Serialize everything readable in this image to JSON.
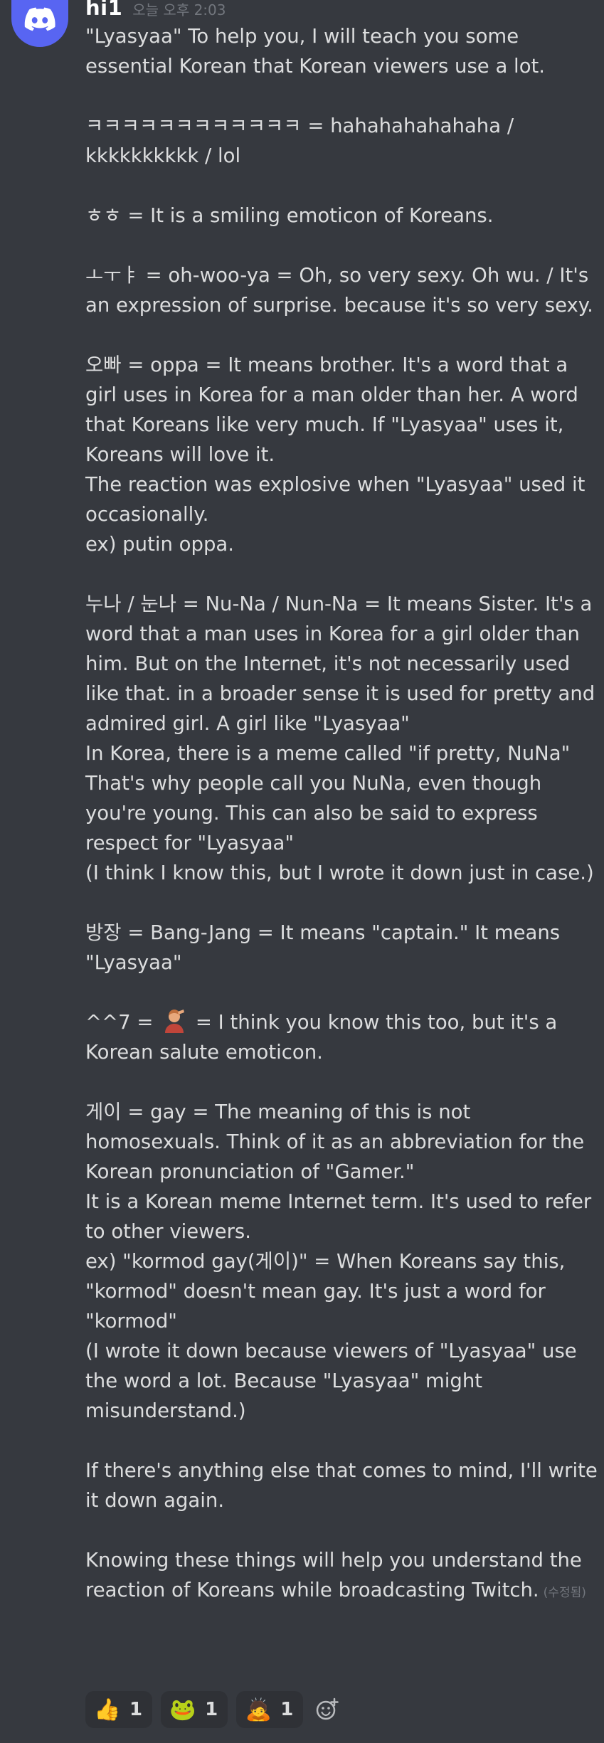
{
  "message": {
    "author": "hi1",
    "timestamp": "오늘 오후 2:03",
    "edited_label": "(수정됨)",
    "paragraphs": {
      "p0": "\"Lyasyaa\" To help you, I will teach you some essential Korean that Korean viewers use a lot.",
      "p1": "ㅋㅋㅋㅋㅋㅋㅋㅋㅋㅋㅋㅋ = hahahahahahaha / kkkkkkkkkk / lol",
      "p2": "ㅎㅎ = It is a smiling emoticon of Koreans.",
      "p3": "ㅗㅜㅑ = oh-woo-ya = Oh, so very sexy. Oh wu. / It's an expression of surprise. because it's so very sexy.",
      "p4": "오빠 = oppa = It means brother. It's a word that a girl uses in Korea for a man older than her. A word that Koreans like very much. If \"Lyasyaa\" uses it, Koreans will love it.\nThe reaction was explosive when \"Lyasyaa\" used it occasionally.\nex) putin oppa.",
      "p5": "누나 / 눈나 = Nu-Na / Nun-Na = It means Sister. It's a word that a man uses in Korea for a girl older than him. But on the Internet, it's not necessarily used like that. in a broader sense it is used for pretty and admired girl. A girl like \"Lyasyaa\"\nIn Korea, there is a meme called \"if pretty, NuNa\" That's why people call you NuNa, even though you're young. This can also be said to express respect for \"Lyasyaa\"\n(I think I know this, but I wrote it down just in case.)",
      "p6": "방장 = Bang-Jang = It means \"captain.\" It means \"Lyasyaa\"",
      "p7_pre": "^^7 = ",
      "p7_post": " = I think you know this too, but it's a Korean salute emoticon.",
      "p8": "게이 = gay = The meaning of this is not homosexuals. Think of it as an abbreviation for the Korean pronunciation of \"Gamer.\"\nIt is a Korean meme Internet term. It's used to refer to other viewers.\nex) \"kormod gay(게이)\" = When Koreans say this, \"kormod\" doesn't mean gay. It's just a word for \"kormod\"\n(I wrote it down because viewers of \"Lyasyaa\" use the word a lot. Because \"Lyasyaa\" might misunderstand.)",
      "p9": "If there's anything else that comes to mind, I'll write it down again.",
      "p10": "Knowing these things will help you understand the reaction of Koreans while broadcasting Twitch."
    }
  },
  "reactions": [
    {
      "emoji": "thumbs-up",
      "glyph": "👍",
      "count": "1"
    },
    {
      "emoji": "pepe-frog",
      "glyph": "🐸",
      "count": "1"
    },
    {
      "emoji": "salute-person",
      "glyph": "🙇",
      "count": "1"
    }
  ],
  "icons": {
    "avatar": "discord-logo-icon",
    "add_reaction": "add-reaction-smiley-icon"
  },
  "colors": {
    "background": "#36393f",
    "avatar_bg": "#5865f2",
    "text": "#dcddde",
    "muted": "#72767d",
    "reaction_bg": "#2f3136"
  }
}
